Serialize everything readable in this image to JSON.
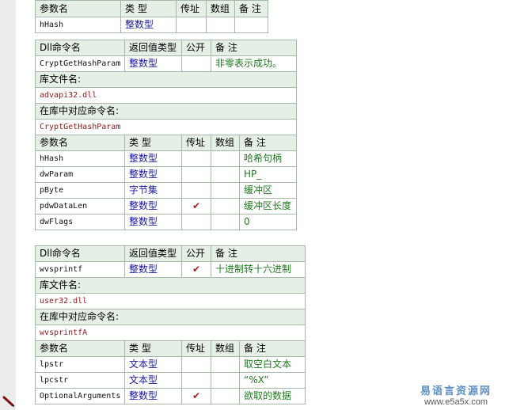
{
  "headers": {
    "param": [
      "参数名",
      "类 型",
      "传址",
      "数组",
      "备 注"
    ],
    "dll": [
      "Dll命令名",
      "返回值类型",
      "公开",
      "备 注"
    ],
    "lib_label": "库文件名:",
    "cmd_label": "在库中对应命令名:"
  },
  "top_table": {
    "rows": [
      {
        "name": "hHash",
        "type": "整数型",
        "byref": "",
        "array": "",
        "note": ""
      }
    ]
  },
  "dll_blocks": [
    {
      "dll_name": "CryptGetHashParam",
      "ret_type": "整数型",
      "public": "",
      "note": "非零表示成功。",
      "lib": "advapi32.dll",
      "cmd": "CryptGetHashParam",
      "params": [
        {
          "name": "hHash",
          "type": "整数型",
          "byref": "",
          "array": "",
          "note": "哈希句柄"
        },
        {
          "name": "dwParam",
          "type": "整数型",
          "byref": "",
          "array": "",
          "note": "HP_"
        },
        {
          "name": "pByte",
          "type": "字节集",
          "byref": "",
          "array": "",
          "note": "缓冲区"
        },
        {
          "name": "pdwDataLen",
          "type": "整数型",
          "byref": "✔",
          "array": "",
          "note": "缓冲区长度"
        },
        {
          "name": "dwFlags",
          "type": "整数型",
          "byref": "",
          "array": "",
          "note": "0"
        }
      ]
    },
    {
      "dll_name": "wvsprintf",
      "ret_type": "整数型",
      "public": "✔",
      "note": "十进制转十六进制",
      "lib": "user32.dll",
      "cmd": "wvsprintfA",
      "params": [
        {
          "name": "lpstr",
          "type": "文本型",
          "byref": "",
          "array": "",
          "note": "取空白文本"
        },
        {
          "name": "lpcstr",
          "type": "文本型",
          "byref": "",
          "array": "",
          "note": "“%X”"
        },
        {
          "name": "OptionalArguments",
          "type": "整数型",
          "byref": "✔",
          "array": "",
          "note": "欲取的数据"
        }
      ]
    }
  ],
  "watermark": {
    "cn": "易语言资源网",
    "url": "www.e5a5x.com"
  },
  "icons": {
    "pencil": "pencil-icon",
    "check": "checkmark-icon"
  }
}
